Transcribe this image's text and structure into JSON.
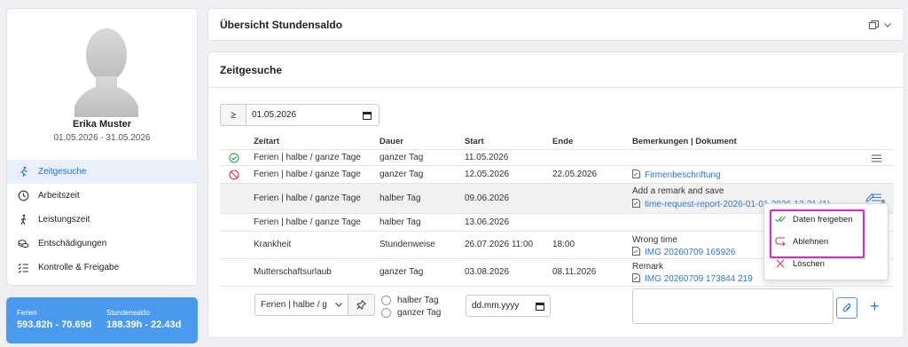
{
  "profile": {
    "name": "Erika Muster",
    "period": "01.05.2026 - 31.05.2026",
    "nav": [
      {
        "label": "Zeitgesuche",
        "icon": "running-figure-icon",
        "active": true
      },
      {
        "label": "Arbeitszeit",
        "icon": "clock-icon"
      },
      {
        "label": "Leistungszeit",
        "icon": "walking-figure-icon"
      },
      {
        "label": "Entschädigungen",
        "icon": "coins-icon"
      },
      {
        "label": "Kontrolle & Freigabe",
        "icon": "checklist-icon"
      }
    ]
  },
  "saldo": {
    "ferien_label": "Ferien",
    "ferien_value": "593.82h - 70.69d",
    "stunden_label": "Stundensaldo",
    "stunden_value": "188.39h - 22.43d"
  },
  "top_card": {
    "title": "Übersicht Stundensaldo"
  },
  "main_card": {
    "title": "Zeitgesuche",
    "filter": {
      "operator": "≥",
      "date": "01.05.2026"
    },
    "columns": [
      "Zeitart",
      "Dauer",
      "Start",
      "Ende",
      "Bemerkungen | Dokument"
    ],
    "rows": [
      {
        "status": "approved",
        "zeitart": "Ferien | halbe / ganze Tage",
        "dauer": "ganzer Tag",
        "start": "11.05.2026",
        "ende": "",
        "remark": "",
        "doc": "",
        "menu": true
      },
      {
        "status": "rejected",
        "zeitart": "Ferien | halbe / ganze Tage",
        "dauer": "ganzer Tag",
        "start": "12.05.2026",
        "ende": "22.05.2026",
        "remark": "",
        "doc": "Firmenbeschriftung",
        "menu": false
      },
      {
        "status": "",
        "zeitart": "Ferien | halbe / ganze Tage",
        "dauer": "halber Tag",
        "start": "09.06.2026",
        "ende": "",
        "remark": "Add a remark and save",
        "doc": "time-request-report-2026-01-01-2026-12-31 (1)",
        "menu": true
      },
      {
        "status": "",
        "zeitart": "Ferien | halbe / ganze Tage",
        "dauer": "halber Tag",
        "start": "13.06.2026",
        "ende": "",
        "remark": "",
        "doc": "",
        "menu": false
      },
      {
        "status": "",
        "zeitart": "Krankheit",
        "dauer": "Stundenweise",
        "start": "26.07.2026 11:00",
        "ende": "18:00",
        "remark": "Wrong time",
        "doc": "IMG 20260709 165926",
        "menu": false
      },
      {
        "status": "",
        "zeitart": "Mutterschaftsurlaub",
        "dauer": "ganzer Tag",
        "start": "03.08.2026",
        "ende": "08.11.2026",
        "remark": "Remark",
        "doc": "IMG 20260709 173844 219",
        "menu": false
      }
    ],
    "new_entry": {
      "type_value": "Ferien | halbe / g",
      "radio_half": "halber Tag",
      "radio_full": "ganzer Tag",
      "date_placeholder": "dd.mm.yyyy"
    }
  },
  "dropdown": {
    "items": [
      {
        "label": "Daten freigeben",
        "icon": "double-check-icon",
        "color": "#2e9e4f"
      },
      {
        "label": "Ablehnen",
        "icon": "return-arrow-icon",
        "color": "#d9364a"
      },
      {
        "label": "Löschen",
        "icon": "close-icon",
        "color": "#d9364a"
      }
    ]
  }
}
